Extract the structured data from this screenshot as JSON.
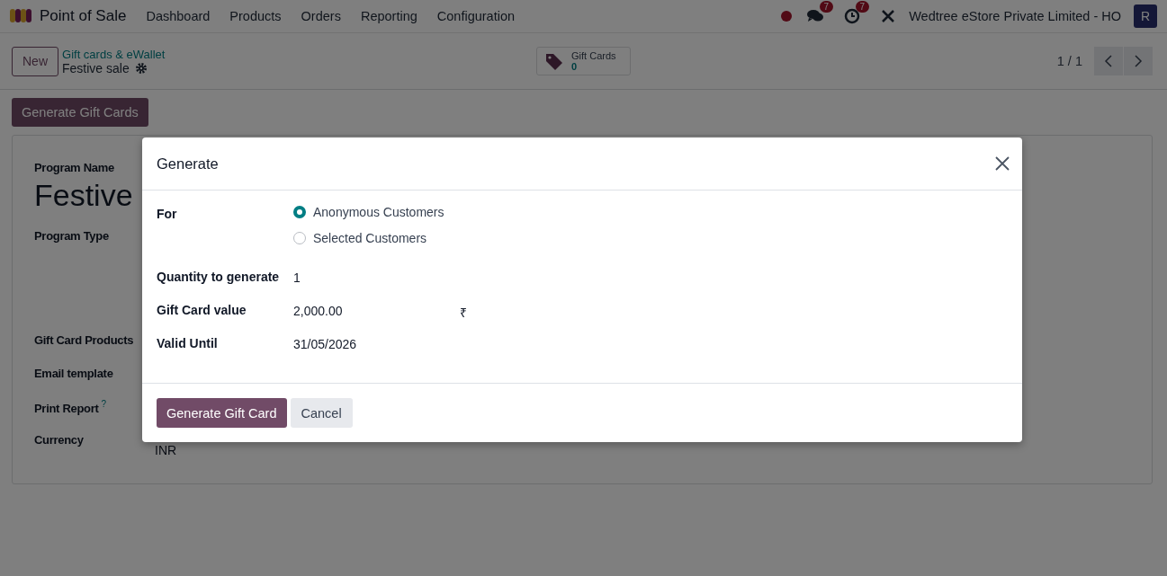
{
  "navbar": {
    "app_name": "Point of Sale",
    "menu": [
      "Dashboard",
      "Products",
      "Orders",
      "Reporting",
      "Configuration"
    ],
    "messages_count": "7",
    "activities_count": "7",
    "company": "Wedtree eStore Private Limited - HO",
    "avatar": "R"
  },
  "control_panel": {
    "new_button": "New",
    "breadcrumb": "Gift cards & eWallet",
    "record_name": "Festive sale",
    "smart_button": {
      "label": "Gift Cards",
      "count": "0"
    },
    "pager": "1 / 1"
  },
  "action_button": "Generate Gift Cards",
  "form": {
    "program_name_label": "Program Name",
    "program_name": "Festive",
    "fields": [
      {
        "label": "Program Type"
      },
      {
        "label": "Gift Card Products"
      },
      {
        "label": "Email template"
      },
      {
        "label": "Print Report",
        "help": "?"
      },
      {
        "label": "Currency",
        "value": "INR"
      }
    ]
  },
  "dialog": {
    "title": "Generate",
    "for_label": "For",
    "options": [
      {
        "label": "Anonymous Customers",
        "selected": true
      },
      {
        "label": "Selected Customers",
        "selected": false
      }
    ],
    "fields": [
      {
        "label": "Quantity to generate",
        "value": "1"
      },
      {
        "label": "Gift Card value",
        "value": "2,000.00",
        "currency": "₹"
      },
      {
        "label": "Valid Until",
        "value": "31/05/2026"
      }
    ],
    "buttons": {
      "primary": "Generate Gift Card",
      "secondary": "Cancel"
    }
  }
}
